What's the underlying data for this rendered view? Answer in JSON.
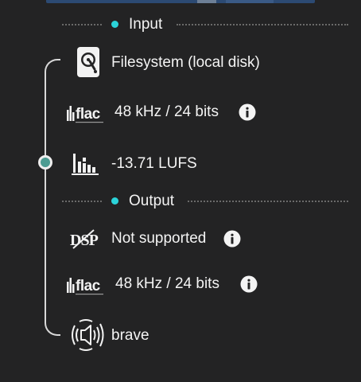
{
  "colors": {
    "background": "#232324",
    "accent_bullet": "#2bd3d9",
    "node_fill": "#4c9c92",
    "text": "#f4f4f4",
    "dots": "#6a6a6a",
    "line": "#d8d8d8"
  },
  "input": {
    "header": "Input",
    "source": {
      "icon": "hard-disk-icon",
      "label": "Filesystem (local disk)"
    },
    "format": {
      "icon": "flac-logo-icon",
      "label": "48 kHz / 24 bits",
      "info_icon": "info-icon"
    },
    "loudness": {
      "icon": "loudness-bars-icon",
      "label": "-13.71 LUFS"
    }
  },
  "output": {
    "header": "Output",
    "dsp": {
      "icon": "dsp-disabled-icon",
      "label": "Not supported",
      "info_icon": "info-icon"
    },
    "format": {
      "icon": "flac-logo-icon",
      "label": "48 kHz / 24 bits",
      "info_icon": "info-icon"
    },
    "device": {
      "icon": "speaker-icon",
      "label": "brave"
    }
  }
}
